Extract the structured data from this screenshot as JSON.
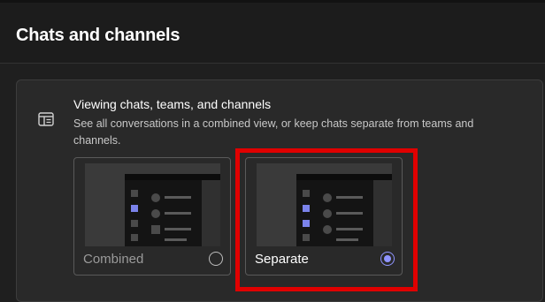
{
  "header": {
    "title": "Chats and channels"
  },
  "card": {
    "icon": "layout-icon",
    "heading": "Viewing chats, teams, and channels",
    "description": "See all conversations in a combined view, or keep chats separate from teams and channels."
  },
  "options": [
    {
      "label": "Combined",
      "selected": false
    },
    {
      "label": "Separate",
      "selected": true
    }
  ],
  "colors": {
    "accent": "#8f94ff",
    "highlight": "#e00000"
  }
}
